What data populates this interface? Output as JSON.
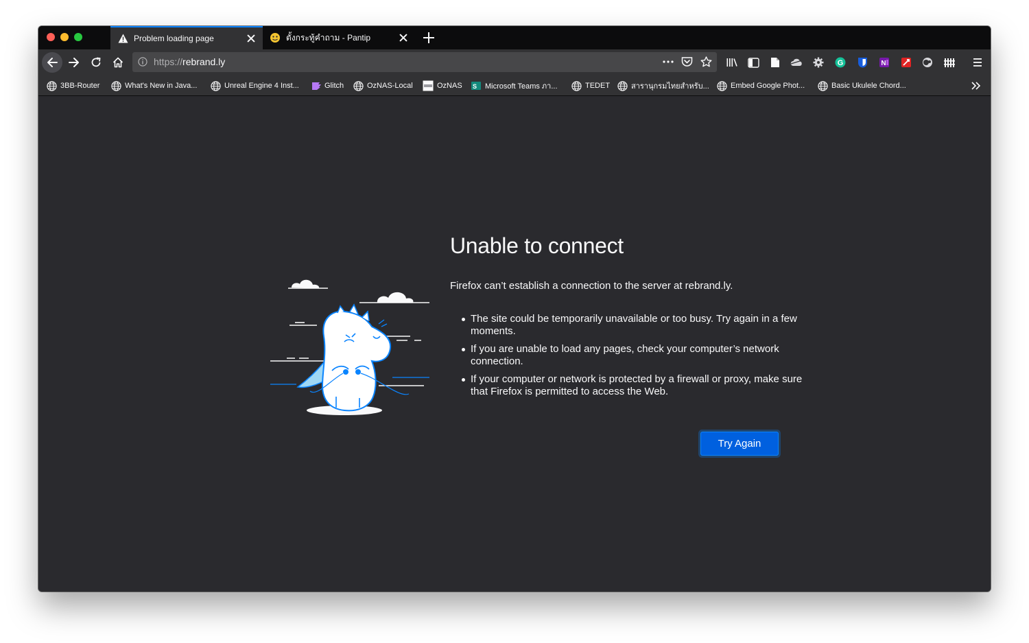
{
  "tabs": [
    {
      "title": "Problem loading page",
      "icon": "warning-icon",
      "active": true
    },
    {
      "title": "ตั้งกระทู้คำถาม - Pantip",
      "icon": "pantip-favicon",
      "active": false
    }
  ],
  "navbar": {
    "url_scheme": "https://",
    "url_host": "rebrand.ly"
  },
  "bookmarks": [
    {
      "label": "3BB-Router",
      "icon": "globe-icon"
    },
    {
      "label": "What's New in Java...",
      "icon": "globe-icon"
    },
    {
      "label": "Unreal Engine 4 Inst...",
      "icon": "globe-icon"
    },
    {
      "label": "Glitch",
      "icon": "glitch-icon"
    },
    {
      "label": "OzNAS-Local",
      "icon": "globe-icon"
    },
    {
      "label": "OzNAS",
      "icon": "synology-icon"
    },
    {
      "label": "Microsoft Teams ภา...",
      "icon": "teams-icon"
    },
    {
      "label": "TEDET",
      "icon": "globe-icon"
    },
    {
      "label": "สารานุกรมไทยสำหรับ...",
      "icon": "globe-icon"
    },
    {
      "label": "Embed Google Phot...",
      "icon": "globe-icon"
    },
    {
      "label": "Basic Ukulele Chord...",
      "icon": "globe-icon"
    }
  ],
  "error": {
    "title": "Unable to connect",
    "description": "Firefox can’t establish a connection to the server at rebrand.ly.",
    "items": [
      "The site could be temporarily unavailable or too busy. Try again in a few moments.",
      "If you are unable to load any pages, check your computer’s network connection.",
      "If your computer or network is protected by a firewall or proxy, make sure that Firefox is permitted to access the Web."
    ],
    "button": "Try Again"
  },
  "colors": {
    "tab_accent": "#0a84ff",
    "button_bg": "#0060df",
    "content_bg": "#2a2a2e",
    "toolbar_bg": "#323234"
  }
}
